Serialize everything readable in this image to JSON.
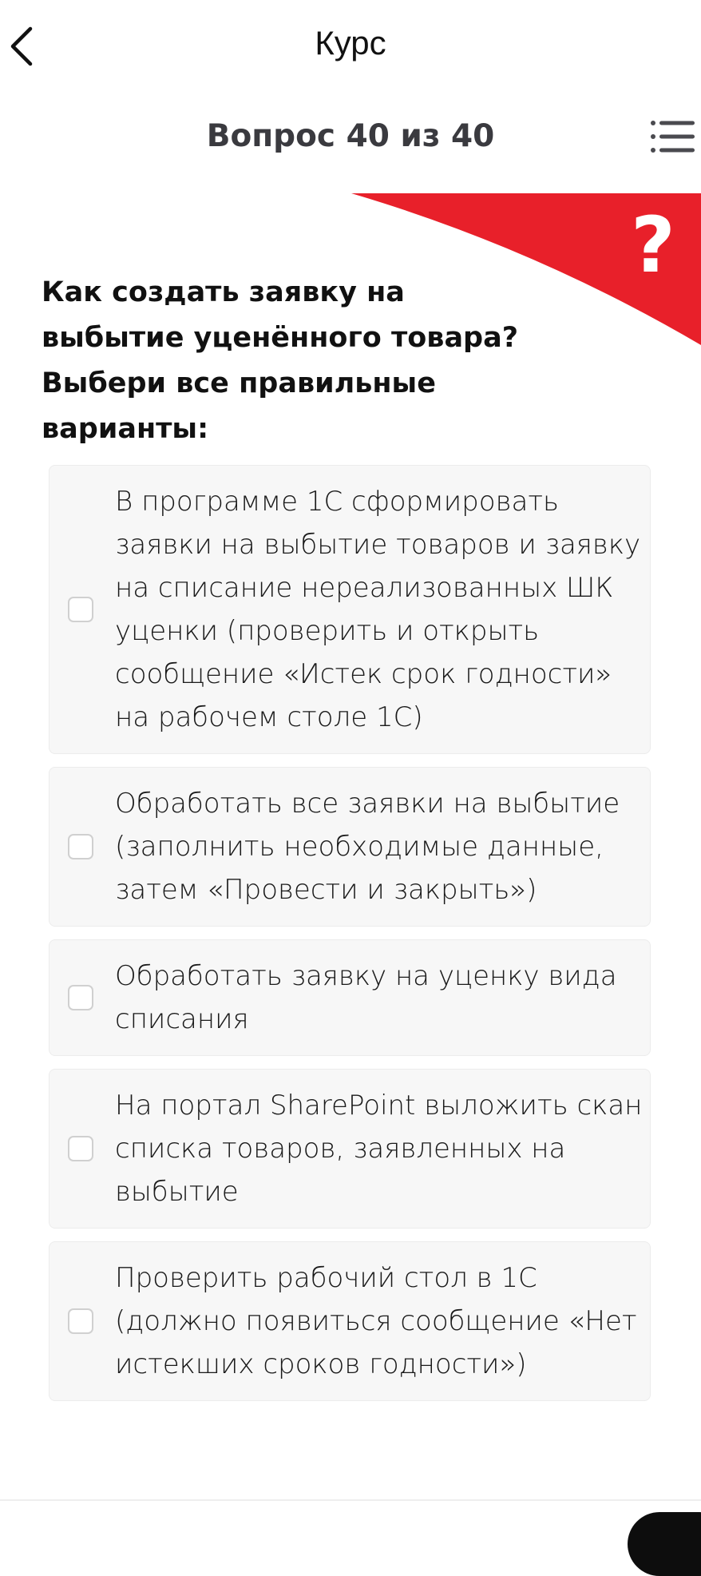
{
  "header": {
    "title": "Курс",
    "back_icon": "chevron-left-icon"
  },
  "quiz": {
    "counter": "Вопрос 40 из 40",
    "list_icon": "list-icon",
    "banner_color": "#e8202a",
    "banner_icon": "question-mark-icon",
    "question": "Как создать заявку на выбытие уценённого товара? Выбери все правильные варианты:",
    "options": [
      {
        "text": "В программе 1С сформировать заявки на выбытие товаров и заявку на списание нереализованных ШК уценки (проверить и открыть сообщение «Истек срок годности» на рабочем столе 1С)",
        "checked": false
      },
      {
        "text": "Обработать все заявки на выбытие (заполнить необходимые данные, затем «Провести и закрыть»)",
        "checked": false
      },
      {
        "text": "Обработать заявку на уценку вида списания",
        "checked": false
      },
      {
        "text": "На портал SharePoint выложить скан списка товаров, заявленных на выбытие",
        "checked": false
      },
      {
        "text": "Проверить рабочий стол в 1С (должно появиться сообщение «Нет истекших сроков годности»)",
        "checked": false
      }
    ]
  }
}
